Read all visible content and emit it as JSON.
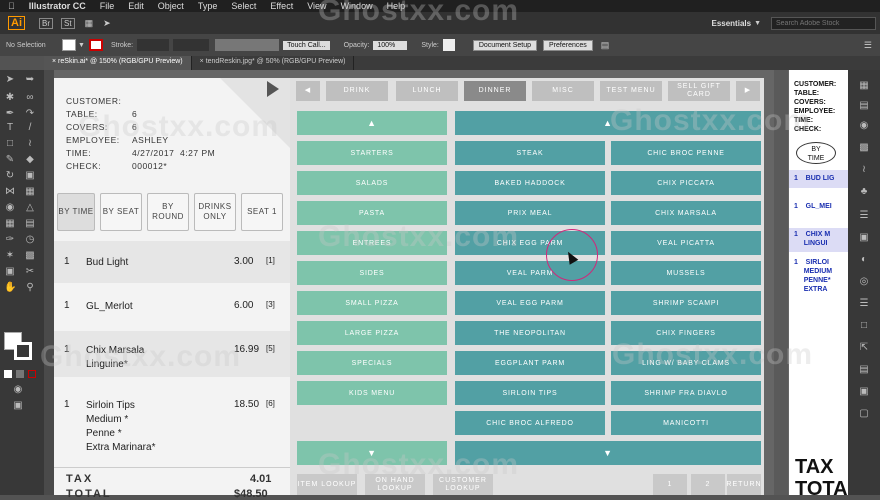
{
  "menubar": {
    "app": "Illustrator CC",
    "items": [
      "File",
      "Edit",
      "Object",
      "Type",
      "Select",
      "Effect",
      "View",
      "Window",
      "Help"
    ]
  },
  "appbar": {
    "logo": "Ai",
    "br": "Br",
    "st": "St",
    "workspace": "Essentials",
    "search_placeholder": "Search Adobe Stock"
  },
  "ctrlbar": {
    "selection": "No Selection",
    "stroke": "Stroke:",
    "brush": "Touch Call...",
    "opacity_label": "Opacity:",
    "opacity": "100%",
    "style_label": "Style:",
    "doc_setup": "Document Setup",
    "preferences": "Preferences"
  },
  "tabs": [
    {
      "label": "reSkin.ai* @ 150% (RGB/GPU Preview)"
    },
    {
      "label": "tendReskin.jpg* @ 50% (RGB/GPU Preview)"
    }
  ],
  "order": {
    "labels": [
      "CUSTOMER:",
      "TABLE:",
      "COVERS:",
      "EMPLOYEE:",
      "TIME:",
      "CHECK:"
    ],
    "values": [
      "",
      "6",
      "6",
      "ASHLEY",
      "4/27/2017  4:27 PM",
      "000012*"
    ],
    "sort_buttons": [
      "BY TIME",
      "BY SEAT",
      "BY ROUND",
      "DRINKS ONLY",
      "SEAT 1"
    ],
    "items": [
      {
        "qty": "1",
        "name": "Bud Light",
        "price": "3.00",
        "seat": "[1]"
      },
      {
        "qty": "1",
        "name": "GL_Merlot",
        "price": "6.00",
        "seat": "[3]"
      },
      {
        "qty": "1",
        "name": "Chix Marsala\nLinguine*",
        "price": "16.99",
        "seat": "[5]"
      },
      {
        "qty": "1",
        "name": "Sirloin Tips\nMedium *\nPenne *\nExtra Marinara*",
        "price": "18.50",
        "seat": "[6]"
      }
    ],
    "tax_label": "TAX",
    "tax": "4.01",
    "total_label": "TOTAL",
    "total": "$48.50"
  },
  "menu": {
    "categories": [
      "DRINK",
      "LUNCH",
      "DINNER",
      "MISC",
      "TEST MENU",
      "SELL GIFT CARD"
    ],
    "selected_category": "DINNER",
    "groups": [
      "STARTERS",
      "SALADS",
      "PASTA",
      "ENTREES",
      "SIDES",
      "SMALL PIZZA",
      "LARGE PIZZA",
      "SPECIALS",
      "KIDS MENU"
    ],
    "items": [
      "STEAK",
      "CHIC BROC PENNE",
      "BAKED HADDOCK",
      "CHIX PICCATA",
      "PRIX MEAL",
      "CHIX MARSALA",
      "CHIX EGG PARM",
      "VEAL PICATTA",
      "VEAL PARM",
      "MUSSELS",
      "VEAL EGG PARM",
      "SHRIMP SCAMPI",
      "THE NEOPOLITAN",
      "CHIX FINGERS",
      "EGGPLANT PARM",
      "LING W/ BABY CLAMS",
      "SIRLOIN TIPS",
      "SHRIMP FRA DIAVLO",
      "CHIC BROC ALFREDO",
      "MANICOTTI"
    ],
    "bottom": [
      "ITEM LOOKUP",
      "ON HAND LOOKUP",
      "CUSTOMER LOOKUP",
      "1",
      "2",
      "RETURN"
    ]
  },
  "doc2": {
    "labels": [
      "CUSTOMER:",
      "TABLE:",
      "COVERS:",
      "EMPLOYEE:",
      "TIME:",
      "CHECK:"
    ],
    "bytime": "BY TIME",
    "items": [
      "1    BUD LIG",
      "1    GL_MEI",
      "1    CHIX M\n     LINGUI",
      "1    SIRLOI\n     MEDIUM\n     PENNE*\n     EXTRA"
    ],
    "tax": "TAX",
    "total": "TOTA"
  },
  "watermark": "Ghostxx.com",
  "colors": {
    "group_green": "#7ec4ab",
    "item_teal": "#52a0a4",
    "tab_selected": "#8a8a8a",
    "cursor_ring": "#d0277a"
  }
}
